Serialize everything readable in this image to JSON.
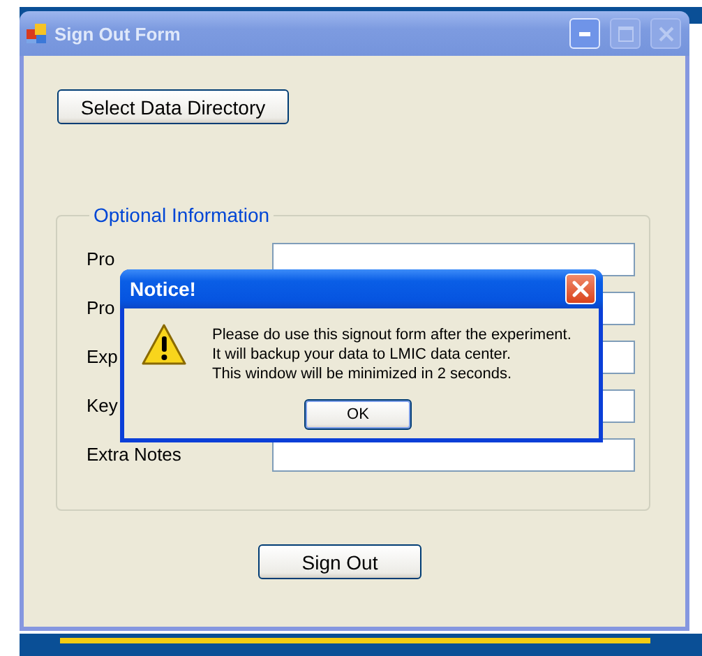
{
  "window": {
    "title": "Sign Out Form"
  },
  "select_button": "Select Data Directory",
  "group": {
    "title": "Optional Information",
    "fields": [
      {
        "label": "Pro"
      },
      {
        "label": "Pro"
      },
      {
        "label": "Exp"
      },
      {
        "label": "Key"
      },
      {
        "label": "Extra Notes"
      }
    ]
  },
  "sign_out_button": "Sign Out",
  "dialog": {
    "title": "Notice!",
    "message": [
      "Please do use this signout form after the experiment.",
      "It will backup your data to LMIC data center.",
      "This window will be minimized in 2 seconds."
    ],
    "ok_button": "OK"
  }
}
